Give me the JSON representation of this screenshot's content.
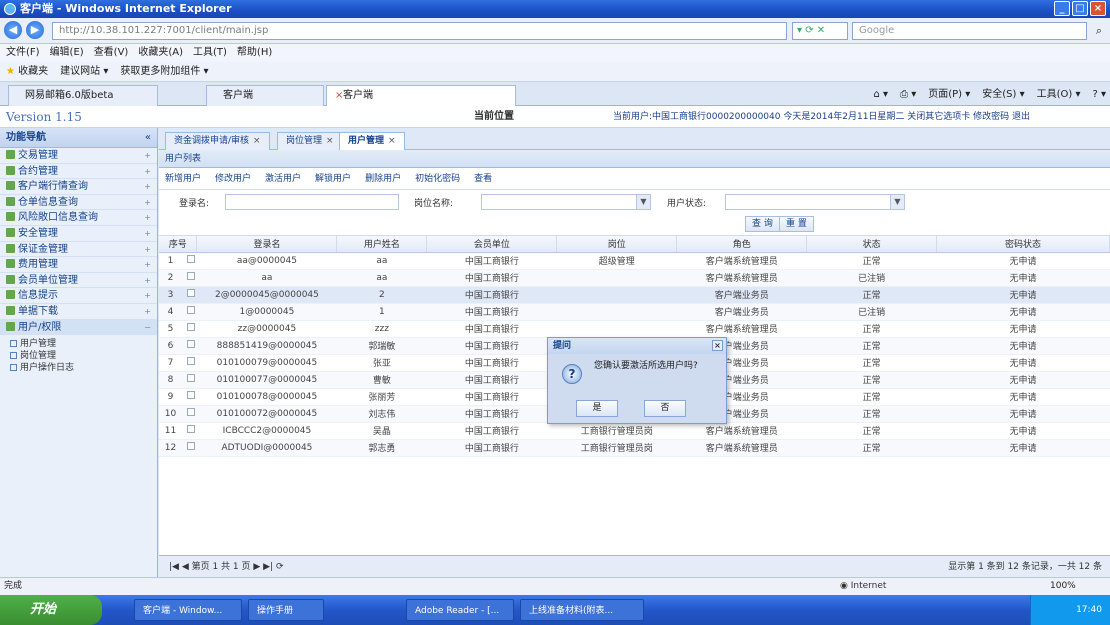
{
  "window": {
    "title": "客户端 - Windows Internet Explorer"
  },
  "address": {
    "url": "http://10.38.101.227:7001/client/main.jsp",
    "search_placeholder": "Google"
  },
  "menu": [
    "文件(F)",
    "编辑(E)",
    "查看(V)",
    "收藏夹(A)",
    "工具(T)",
    "帮助(H)"
  ],
  "favorites": {
    "label": "收藏夹",
    "items": [
      "建议网站 ▾",
      "获取更多附加组件 ▾"
    ]
  },
  "browser_tabs": [
    {
      "label": "网易邮箱6.0版beta"
    },
    {
      "label": "客户端"
    },
    {
      "label": "客户端"
    }
  ],
  "browser_tools": [
    "页面(P) ▾",
    "安全(S) ▾",
    "工具(O) ▾"
  ],
  "header": {
    "version": "Version 1.15",
    "location": "当前位置",
    "user_info": "当前用户:中国工商银行0000200000040  今天是2014年2月11日星期二  关闭其它选项卡  修改密码  退出"
  },
  "sidebar": {
    "title": "功能导航",
    "items": [
      {
        "label": "交易管理",
        "open": false
      },
      {
        "label": "合约管理",
        "open": false
      },
      {
        "label": "客户端行情查询",
        "open": false
      },
      {
        "label": "仓单信息查询",
        "open": false
      },
      {
        "label": "风险敞口信息查询",
        "open": false
      },
      {
        "label": "安全管理",
        "open": false
      },
      {
        "label": "保证金管理",
        "open": false
      },
      {
        "label": "费用管理",
        "open": false
      },
      {
        "label": "会员单位管理",
        "open": false
      },
      {
        "label": "信息提示",
        "open": false
      },
      {
        "label": "单据下载",
        "open": false
      },
      {
        "label": "用户/权限",
        "open": true
      }
    ],
    "subitems": [
      "用户管理",
      "岗位管理",
      "用户操作日志"
    ]
  },
  "content_tabs": [
    {
      "label": "资金调拨申请/审核"
    },
    {
      "label": "岗位管理"
    },
    {
      "label": "用户管理"
    }
  ],
  "panel": {
    "title": "用户列表",
    "toolbar": [
      "新增用户",
      "修改用户",
      "激活用户",
      "解锁用户",
      "删除用户",
      "初始化密码",
      "查看"
    ]
  },
  "filters": {
    "login_label": "登录名:",
    "post_label": "岗位名称:",
    "status_label": "用户状态:",
    "search_button": "查 询",
    "reset_button": "重 置"
  },
  "table": {
    "headers": [
      "序号",
      "登录名",
      "用户姓名",
      "会员单位",
      "岗位",
      "角色",
      "状态",
      "密码状态"
    ],
    "rows": [
      {
        "no": "1",
        "login": "aa@0000045",
        "name": "aa",
        "unit": "中国工商银行",
        "post": "超级管理",
        "role": "客户端系统管理员",
        "status": "正常",
        "pwd": "无申请"
      },
      {
        "no": "2",
        "login": "aa",
        "name": "aa",
        "unit": "中国工商银行",
        "post": "",
        "role": "客户端系统管理员",
        "status": "已注销",
        "pwd": "无申请"
      },
      {
        "no": "3",
        "login": "2@0000045@0000045",
        "name": "2",
        "unit": "中国工商银行",
        "post": "",
        "role": "客户端业务员",
        "status": "正常",
        "pwd": "无申请"
      },
      {
        "no": "4",
        "login": "1@0000045",
        "name": "1",
        "unit": "中国工商银行",
        "post": "",
        "role": "客户端业务员",
        "status": "已注销",
        "pwd": "无申请"
      },
      {
        "no": "5",
        "login": "zz@0000045",
        "name": "zzz",
        "unit": "中国工商银行",
        "post": "",
        "role": "客户端系统管理员",
        "status": "正常",
        "pwd": "无申请"
      },
      {
        "no": "6",
        "login": "888851419@0000045",
        "name": "郭瑞敏",
        "unit": "中国工商银行",
        "post": "",
        "role": "客户端业务员",
        "status": "正常",
        "pwd": "无申请"
      },
      {
        "no": "7",
        "login": "010100079@0000045",
        "name": "张亚",
        "unit": "中国工商银行",
        "post": "工商银行前端业务员",
        "role": "客户端业务员",
        "status": "正常",
        "pwd": "无申请"
      },
      {
        "no": "8",
        "login": "010100077@0000045",
        "name": "曹敏",
        "unit": "中国工商银行",
        "post": "工商银行前端业务员",
        "role": "客户端业务员",
        "status": "正常",
        "pwd": "无申请"
      },
      {
        "no": "9",
        "login": "010100078@0000045",
        "name": "张丽芳",
        "unit": "中国工商银行",
        "post": "工商银行前端业务员",
        "role": "客户端业务员",
        "status": "正常",
        "pwd": "无申请"
      },
      {
        "no": "10",
        "login": "010100072@0000045",
        "name": "刘志伟",
        "unit": "中国工商银行",
        "post": "工商银行前端业务员",
        "role": "客户端业务员",
        "status": "正常",
        "pwd": "无申请"
      },
      {
        "no": "11",
        "login": "ICBCCC2@0000045",
        "name": "吴晶",
        "unit": "中国工商银行",
        "post": "工商银行管理员岗",
        "role": "客户端系统管理员",
        "status": "正常",
        "pwd": "无申请"
      },
      {
        "no": "12",
        "login": "ADTUODI@0000045",
        "name": "郭志勇",
        "unit": "中国工商银行",
        "post": "工商银行管理员岗",
        "role": "客户端系统管理员",
        "status": "正常",
        "pwd": "无申请"
      }
    ]
  },
  "pager": {
    "text": "|◀ ◀ 第页 1 共 1 页 ▶ ▶| ⟳",
    "info": "显示第 1 条到 12 条记录，一共 12 条"
  },
  "dialog": {
    "title": "提问",
    "message": "您确认要激活所选用户吗?",
    "yes": "是",
    "no": "否"
  },
  "status": {
    "left": "完成",
    "zone": "Internet",
    "zoom": "100%"
  },
  "taskbar": {
    "start": "开始",
    "tasks": [
      "客户端 - Window...",
      "操作手册",
      "Adobe Reader - [...",
      "上线准备材料(附表..."
    ],
    "clock": "17:40"
  }
}
